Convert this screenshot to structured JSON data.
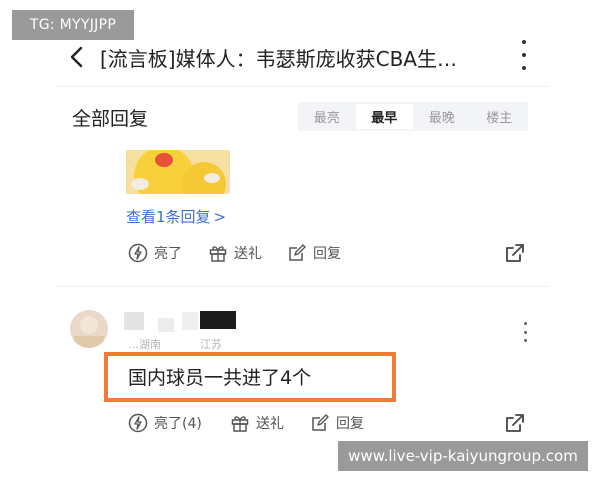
{
  "watermark": {
    "text": "TG: MYYJJPP"
  },
  "header": {
    "title": "[流言板]媒体人：韦瑟斯庞收获CBA生…",
    "back_icon": "chevron-left-icon",
    "more_icon": "vertical-ellipsis-icon"
  },
  "replies": {
    "section_title": "全部回复",
    "sort_tabs": [
      {
        "label": "最亮",
        "active": false
      },
      {
        "label": "最早",
        "active": true
      },
      {
        "label": "最晚",
        "active": false
      },
      {
        "label": "楼主",
        "active": false
      }
    ]
  },
  "first_reply": {
    "view_replies_label": "查看1条回复",
    "view_replies_chevron": ">",
    "actions": {
      "like_label": "亮了",
      "gift_label": "送礼",
      "reply_label": "回复"
    }
  },
  "second_reply": {
    "user_name_partial": "…湖南",
    "location": "江苏",
    "comment": "国内球员一共进了4个",
    "actions": {
      "like_label": "亮了(4)",
      "gift_label": "送礼",
      "reply_label": "回复"
    }
  },
  "url_banner": {
    "text": "www.live-vip-kaiyungroup.com"
  },
  "colors": {
    "link_blue": "#3f6fd6",
    "highlight_orange": "#f07a36",
    "watermark_gray": "#9a9a9a",
    "sort_bar_bg": "#f3f4f8"
  }
}
